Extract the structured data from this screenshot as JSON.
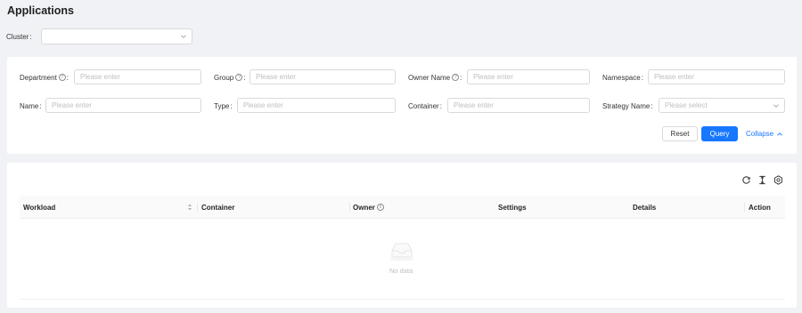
{
  "page": {
    "title": "Applications"
  },
  "cluster": {
    "label": "Cluster",
    "value": ""
  },
  "filters": {
    "department": {
      "label": "Department",
      "placeholder": "Please enter"
    },
    "group": {
      "label": "Group",
      "placeholder": "Please enter"
    },
    "owner_name": {
      "label": "Owner Name",
      "placeholder": "Please enter"
    },
    "namespace": {
      "label": "Namespace",
      "placeholder": "Please enter"
    },
    "name": {
      "label": "Name",
      "placeholder": "Please enter"
    },
    "type": {
      "label": "Type",
      "placeholder": "Please enter"
    },
    "container": {
      "label": "Container",
      "placeholder": "Please enter"
    },
    "strategy_name": {
      "label": "Strategy Name",
      "placeholder": "Please select"
    }
  },
  "actions": {
    "reset": "Reset",
    "query": "Query",
    "collapse": "Collapse"
  },
  "colors": {
    "primary": "#1677ff",
    "background": "#f0f2f5"
  },
  "table": {
    "columns": [
      "Workload",
      "Container",
      "Owner",
      "Settings",
      "Details",
      "Action"
    ],
    "empty_text": "No data",
    "toolbar_icons": [
      "reload-icon",
      "column-height-icon",
      "settings-icon"
    ]
  }
}
